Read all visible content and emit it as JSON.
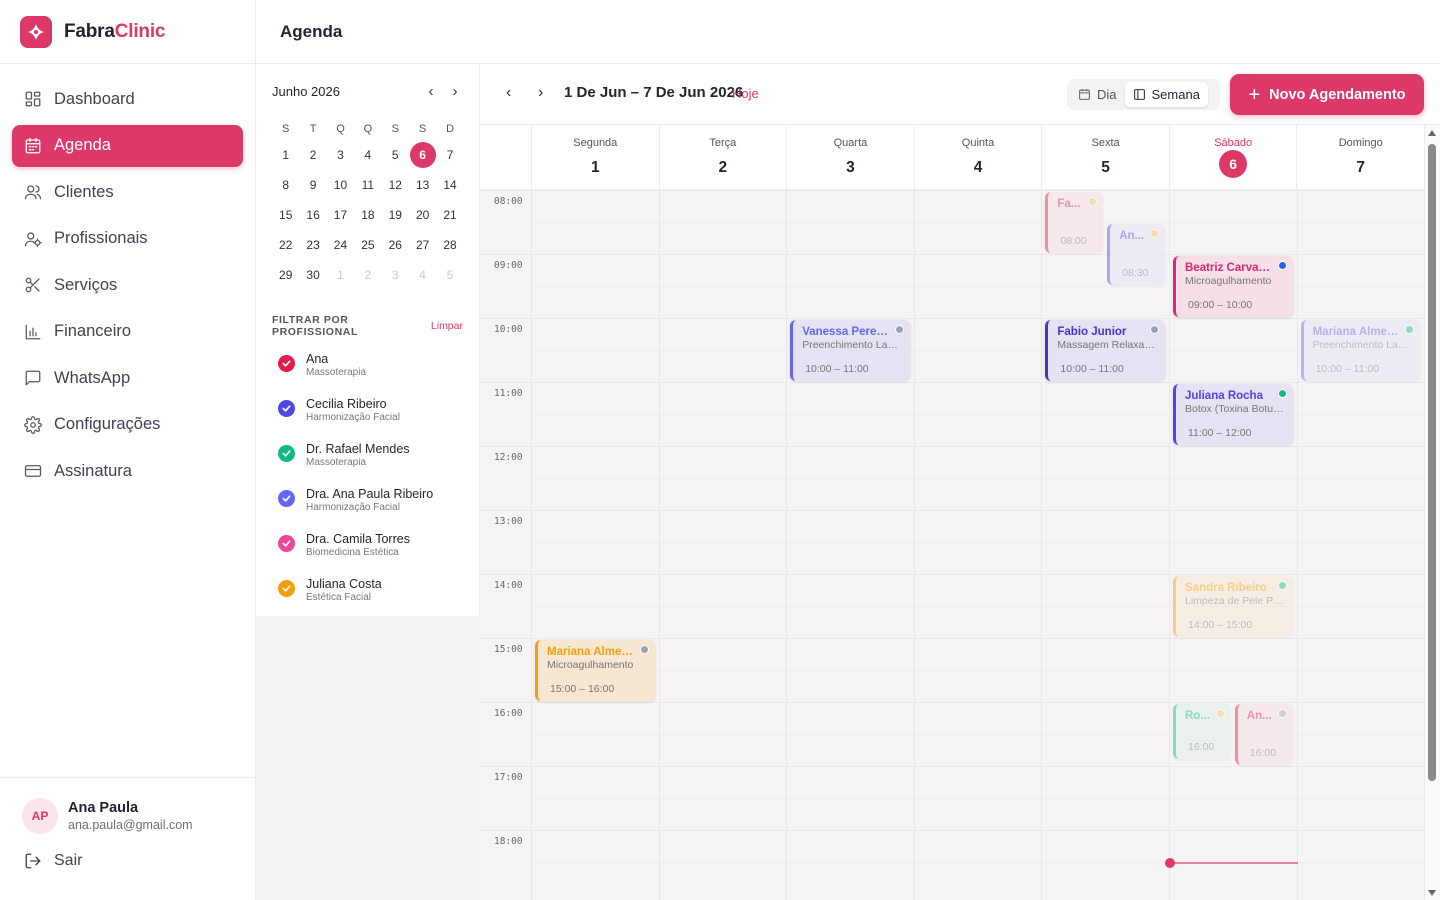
{
  "app": {
    "name_part1": "Fabra",
    "name_part2": "Clinic"
  },
  "sidebar": {
    "items": [
      {
        "label": "Dashboard",
        "icon": "dashboard-icon"
      },
      {
        "label": "Agenda",
        "icon": "calendar-icon",
        "active": true
      },
      {
        "label": "Clientes",
        "icon": "users-icon"
      },
      {
        "label": "Profissionais",
        "icon": "professional-icon"
      },
      {
        "label": "Serviços",
        "icon": "scissors-icon"
      },
      {
        "label": "Financeiro",
        "icon": "chart-icon"
      },
      {
        "label": "WhatsApp",
        "icon": "chat-icon"
      },
      {
        "label": "Configurações",
        "icon": "gear-icon"
      },
      {
        "label": "Assinatura",
        "icon": "card-icon"
      }
    ]
  },
  "user": {
    "initials": "AP",
    "name": "Ana Paula",
    "email": "ana.paula@gmail.com",
    "logout_label": "Sair"
  },
  "header": {
    "title": "Agenda"
  },
  "mini_calendar": {
    "title": "Junho 2026",
    "weekdays": [
      "S",
      "T",
      "Q",
      "Q",
      "S",
      "S",
      "D"
    ],
    "weeks": [
      [
        "1",
        "2",
        "3",
        "4",
        "5",
        "6",
        "7"
      ],
      [
        "8",
        "9",
        "10",
        "11",
        "12",
        "13",
        "14"
      ],
      [
        "15",
        "16",
        "17",
        "18",
        "19",
        "20",
        "21"
      ],
      [
        "22",
        "23",
        "24",
        "25",
        "26",
        "27",
        "28"
      ],
      [
        "29",
        "30",
        "1",
        "2",
        "3",
        "4",
        "5"
      ]
    ],
    "selected": "6"
  },
  "filter": {
    "title": "FILTRAR POR PROFISSIONAL",
    "clear_label": "Limpar",
    "professionals": [
      {
        "name": "Ana",
        "specialty": "Massoterapia",
        "color": "#e11d48"
      },
      {
        "name": "Cecilia Ribeiro",
        "specialty": "Harmonização Facial",
        "color": "#4f46e5"
      },
      {
        "name": "Dr. Rafael Mendes",
        "specialty": "Massoterapia",
        "color": "#10b981"
      },
      {
        "name": "Dra. Ana Paula Ribeiro",
        "specialty": "Harmonização Facial",
        "color": "#6366f1"
      },
      {
        "name": "Dra. Camila Torres",
        "specialty": "Biomedicina Estética",
        "color": "#ec4899"
      },
      {
        "name": "Juliana Costa",
        "specialty": "Estética Facial",
        "color": "#f59e0b"
      }
    ]
  },
  "toolbar": {
    "range": "1 De Jun – 7 De Jun 2026",
    "today_label": "Hoje",
    "view_day": "Dia",
    "view_week": "Semana",
    "new_button": "Novo Agendamento"
  },
  "week": {
    "days": [
      {
        "name": "Segunda",
        "num": "1"
      },
      {
        "name": "Terça",
        "num": "2"
      },
      {
        "name": "Quarta",
        "num": "3"
      },
      {
        "name": "Quinta",
        "num": "4"
      },
      {
        "name": "Sexta",
        "num": "5"
      },
      {
        "name": "Sábado",
        "num": "6",
        "today": true
      },
      {
        "name": "Domingo",
        "num": "7"
      }
    ],
    "hours": [
      "08:00",
      "09:00",
      "10:00",
      "11:00",
      "12:00",
      "13:00",
      "14:00",
      "15:00",
      "16:00",
      "17:00",
      "18:00"
    ],
    "first_hour": 8
  },
  "events": [
    {
      "day": 4,
      "start": 8.0,
      "end": 9.0,
      "client": "Fa...",
      "service": "",
      "time": "08:00",
      "sub": 0,
      "subs": 2,
      "color": "#e11d48",
      "bg": "#f5dde3",
      "status": "#f2c94c",
      "faded": true
    },
    {
      "day": 4,
      "start": 8.5,
      "end": 9.5,
      "client": "An...",
      "service": "",
      "time": "08:30",
      "sub": 1,
      "subs": 2,
      "color": "#4f46e5",
      "bg": "#e4e2f3",
      "status": "#f2c94c",
      "faded": true
    },
    {
      "day": 5,
      "start": 9.0,
      "end": 10.0,
      "client": "Beatriz Carvalho",
      "service": "Microagulhamento",
      "time": "09:00 – 10:00",
      "sub": 0,
      "subs": 1,
      "color": "#db2777",
      "bg": "#f6dfe7",
      "status": "#2563eb"
    },
    {
      "day": 2,
      "start": 10.0,
      "end": 11.0,
      "client": "Vanessa Pereira",
      "service": "Preenchimento Labial",
      "time": "10:00 – 11:00",
      "sub": 0,
      "subs": 1,
      "color": "#6366f1",
      "bg": "#e4e2f3",
      "status": "#9ca3af"
    },
    {
      "day": 4,
      "start": 10.0,
      "end": 11.0,
      "client": "Fabio Junior",
      "service": "Massagem Relaxante",
      "time": "10:00 – 11:00",
      "sub": 0,
      "subs": 1,
      "color": "#4338ca",
      "bg": "#e4e2f3",
      "status": "#9ca3af"
    },
    {
      "day": 6,
      "start": 10.0,
      "end": 11.0,
      "client": "Mariana Almeida",
      "service": "Preenchimento Labial",
      "time": "10:00 – 11:00",
      "sub": 0,
      "subs": 1,
      "color": "#6366f1",
      "bg": "#e4e2f3",
      "status": "#10b981",
      "faded": true
    },
    {
      "day": 5,
      "start": 11.0,
      "end": 12.0,
      "client": "Juliana Rocha",
      "service": "Botox (Toxina Botulínica)",
      "time": "11:00 – 12:00",
      "sub": 0,
      "subs": 1,
      "color": "#4f46e5",
      "bg": "#e4e2f3",
      "status": "#10b981"
    },
    {
      "day": 5,
      "start": 14.0,
      "end": 15.0,
      "client": "Sandra Ribeiro",
      "service": "Limpeza de Pele Profunda",
      "time": "14:00 – 15:00",
      "sub": 0,
      "subs": 1,
      "color": "#f59e0b",
      "bg": "#f6e6d2",
      "status": "#10b981",
      "faded": true
    },
    {
      "day": 0,
      "start": 15.0,
      "end": 16.0,
      "client": "Mariana Almeida",
      "service": "Microagulhamento",
      "time": "15:00 – 16:00",
      "sub": 0,
      "subs": 1,
      "color": "#f59e0b",
      "bg": "#f6e6d2",
      "status": "#9ca3af"
    },
    {
      "day": 5,
      "start": 16.0,
      "end": 16.9,
      "client": "Ro...",
      "service": "",
      "time": "16:00",
      "sub": 0,
      "subs": 2,
      "color": "#10b981",
      "bg": "#dcefe7",
      "status": "#f2c94c",
      "faded": true
    },
    {
      "day": 5,
      "start": 16.0,
      "end": 17.0,
      "client": "An...",
      "service": "",
      "time": "16:00",
      "sub": 1,
      "subs": 2,
      "color": "#e11d48",
      "bg": "#f5dde3",
      "status": "#9ca3af",
      "faded": true
    }
  ],
  "now_indicator": {
    "day": 5,
    "hour": 18.5
  }
}
